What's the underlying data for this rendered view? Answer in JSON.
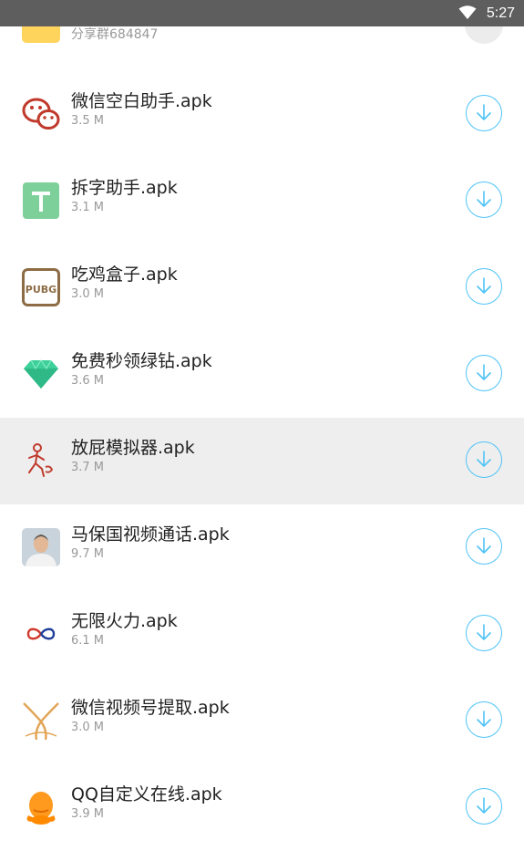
{
  "status_bar": {
    "time": "5:27"
  },
  "header_row": {
    "subtitle": "分享群684847"
  },
  "files": [
    {
      "title": "微信空白助手.apk",
      "size": "3.5 M",
      "icon": "wechat-icon"
    },
    {
      "title": "拆字助手.apk",
      "size": "3.1 M",
      "icon": "letter-t-icon"
    },
    {
      "title": "吃鸡盒子.apk",
      "size": "3.0 M",
      "icon": "pubg-icon",
      "icon_text": "PUBG"
    },
    {
      "title": "免费秒领绿钻.apk",
      "size": "3.6 M",
      "icon": "green-diamond-icon"
    },
    {
      "title": "放屁模拟器.apk",
      "size": "3.7 M",
      "icon": "running-man-icon"
    },
    {
      "title": "马保国视频通话.apk",
      "size": "9.7 M",
      "icon": "portrait-icon"
    },
    {
      "title": "无限火力.apk",
      "size": "6.1 M",
      "icon": "infinity-icon"
    },
    {
      "title": "微信视频号提取.apk",
      "size": "3.0 M",
      "icon": "cross-curves-icon"
    },
    {
      "title": "QQ自定义在线.apk",
      "size": "3.9 M",
      "icon": "qq-penguin-icon"
    }
  ],
  "colors": {
    "accent": "#4fc3f7",
    "highlight_row": "#eeeeee",
    "status_bar": "#5e5e5e"
  }
}
